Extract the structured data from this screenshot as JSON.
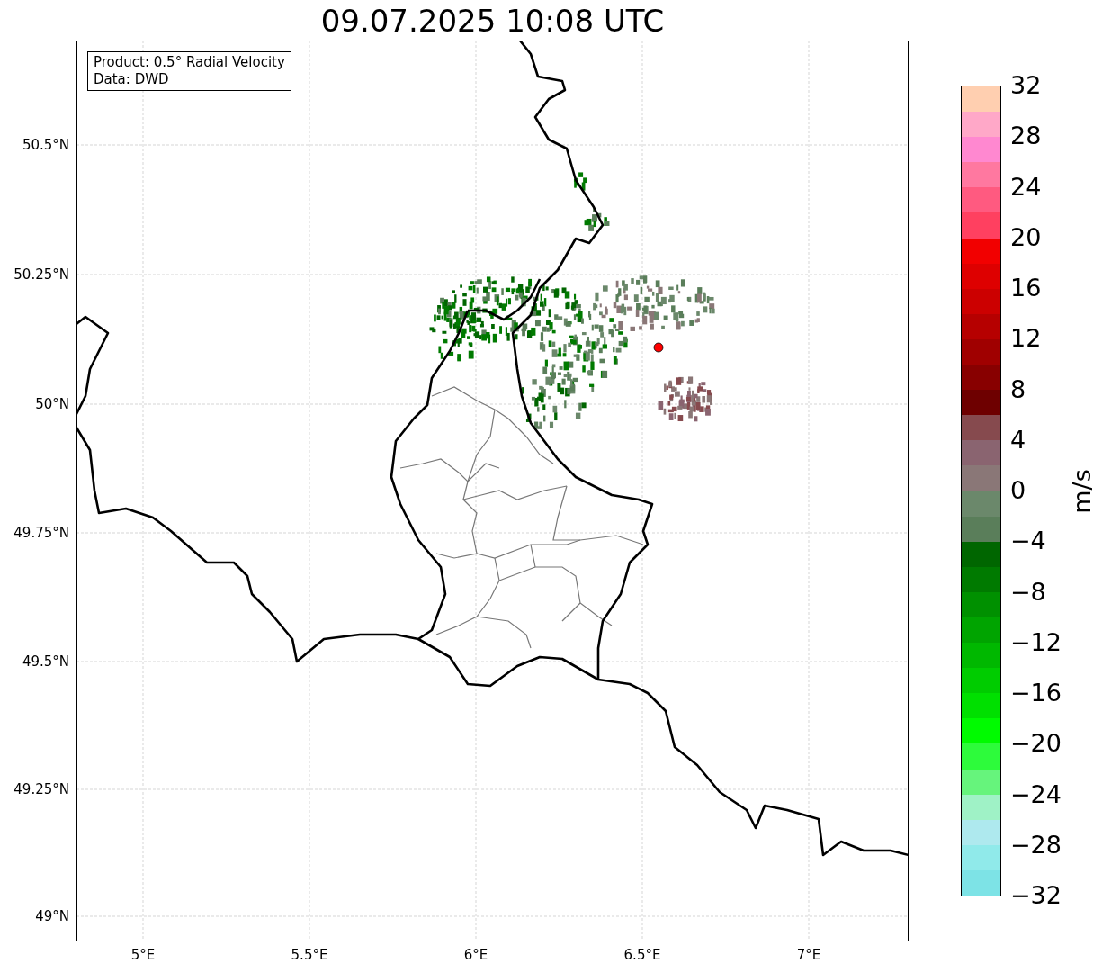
{
  "title": "09.07.2025 10:08 UTC",
  "info_box": [
    "Product: 0.5° Radial Velocity",
    "Data: DWD"
  ],
  "map": {
    "lat_ticks": [
      "50.5°N",
      "50.25°N",
      "50°N",
      "49.75°N",
      "49.5°N",
      "49.25°N",
      "49°N"
    ],
    "lon_ticks": [
      "5°E",
      "5.5°E",
      "6°E",
      "6.5°E",
      "7°E"
    ]
  },
  "colorbar": {
    "label": "m/s",
    "ticks": [
      "32",
      "28",
      "24",
      "20",
      "16",
      "12",
      "8",
      "4",
      "0",
      "−4",
      "−8",
      "−12",
      "−16",
      "−20",
      "−24",
      "−28",
      "−32"
    ],
    "bands": [
      {
        "color": "#ffcfb0"
      },
      {
        "color": "#ffa8c8"
      },
      {
        "color": "#ff88d0"
      },
      {
        "color": "#ff78a0"
      },
      {
        "color": "#ff5a80"
      },
      {
        "color": "#ff4060"
      },
      {
        "color": "#f20000"
      },
      {
        "color": "#de0000"
      },
      {
        "color": "#cc0000"
      },
      {
        "color": "#b60000"
      },
      {
        "color": "#a00000"
      },
      {
        "color": "#880000"
      },
      {
        "color": "#6e0000"
      },
      {
        "color": "#864a4e"
      },
      {
        "color": "#8a6470"
      },
      {
        "color": "#8a7777"
      },
      {
        "color": "#6b886b"
      },
      {
        "color": "#5a7e5a"
      },
      {
        "color": "#006600"
      },
      {
        "color": "#007a00"
      },
      {
        "color": "#009000"
      },
      {
        "color": "#00a400"
      },
      {
        "color": "#00b800"
      },
      {
        "color": "#00cc00"
      },
      {
        "color": "#00e000"
      },
      {
        "color": "#00fb00"
      },
      {
        "color": "#2dfb3b"
      },
      {
        "color": "#66f47c"
      },
      {
        "color": "#9ff2c6"
      },
      {
        "color": "#aee9ee"
      },
      {
        "color": "#90eaea"
      },
      {
        "color": "#7de3e6"
      }
    ]
  }
}
